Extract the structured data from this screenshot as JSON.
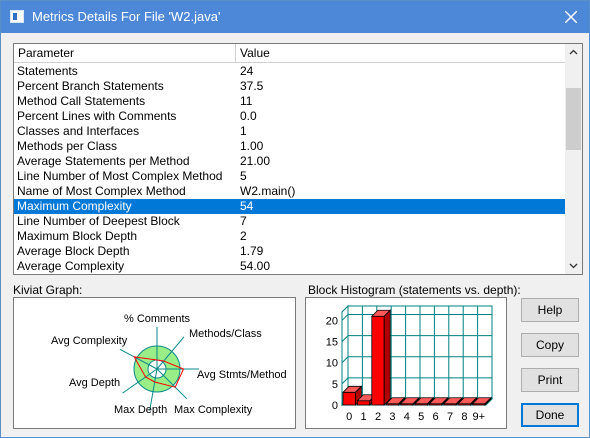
{
  "window": {
    "title": "Metrics Details For File 'W2.java'"
  },
  "table": {
    "headers": {
      "parameter": "Parameter",
      "value": "Value"
    },
    "rows": [
      {
        "parameter": "Statements",
        "value": "24"
      },
      {
        "parameter": "Percent Branch Statements",
        "value": "37.5"
      },
      {
        "parameter": "Method Call Statements",
        "value": "11"
      },
      {
        "parameter": "Percent Lines with Comments",
        "value": "0.0"
      },
      {
        "parameter": "Classes and Interfaces",
        "value": "1"
      },
      {
        "parameter": "Methods per Class",
        "value": "1.00"
      },
      {
        "parameter": "Average Statements per Method",
        "value": "21.00"
      },
      {
        "parameter": "Line Number of Most Complex Method",
        "value": "5"
      },
      {
        "parameter": "Name of Most Complex Method",
        "value": "W2.main()"
      },
      {
        "parameter": "Maximum Complexity",
        "value": "54"
      },
      {
        "parameter": "Line Number of Deepest Block",
        "value": "7"
      },
      {
        "parameter": "Maximum Block Depth",
        "value": "2"
      },
      {
        "parameter": "Average Block Depth",
        "value": "1.79"
      },
      {
        "parameter": "Average Complexity",
        "value": "54.00"
      }
    ],
    "selected_index": 9
  },
  "kiviat": {
    "label": "Kiviat Graph:",
    "axes": [
      {
        "name": "% Comments",
        "value": 0.0
      },
      {
        "name": "Methods/Class",
        "value": 0.1
      },
      {
        "name": "Avg Stmts/Method",
        "value": 1.25
      },
      {
        "name": "Max Complexity",
        "value": 1.2
      },
      {
        "name": "Max Depth",
        "value": 0.3
      },
      {
        "name": "Avg Depth",
        "value": 0.35
      },
      {
        "name": "Avg Complexity",
        "value": 1.2
      }
    ]
  },
  "histogram": {
    "label": "Block Histogram (statements vs. depth):",
    "chart_data": {
      "type": "bar",
      "categories": [
        "0",
        "1",
        "2",
        "3",
        "4",
        "5",
        "6",
        "7",
        "8",
        "9+"
      ],
      "values": [
        3,
        1,
        21,
        0,
        0,
        0,
        0,
        0,
        0,
        0
      ],
      "yticks": [
        0,
        5,
        10,
        15,
        20
      ],
      "ylim": [
        0,
        22
      ],
      "grid": true,
      "bar_color": "#ff0000",
      "grid_color": "#008080"
    }
  },
  "buttons": {
    "help": "Help",
    "copy": "Copy",
    "print": "Print",
    "done": "Done"
  },
  "colors": {
    "titlebar": "#4d88d8",
    "selection": "#0078d7"
  }
}
